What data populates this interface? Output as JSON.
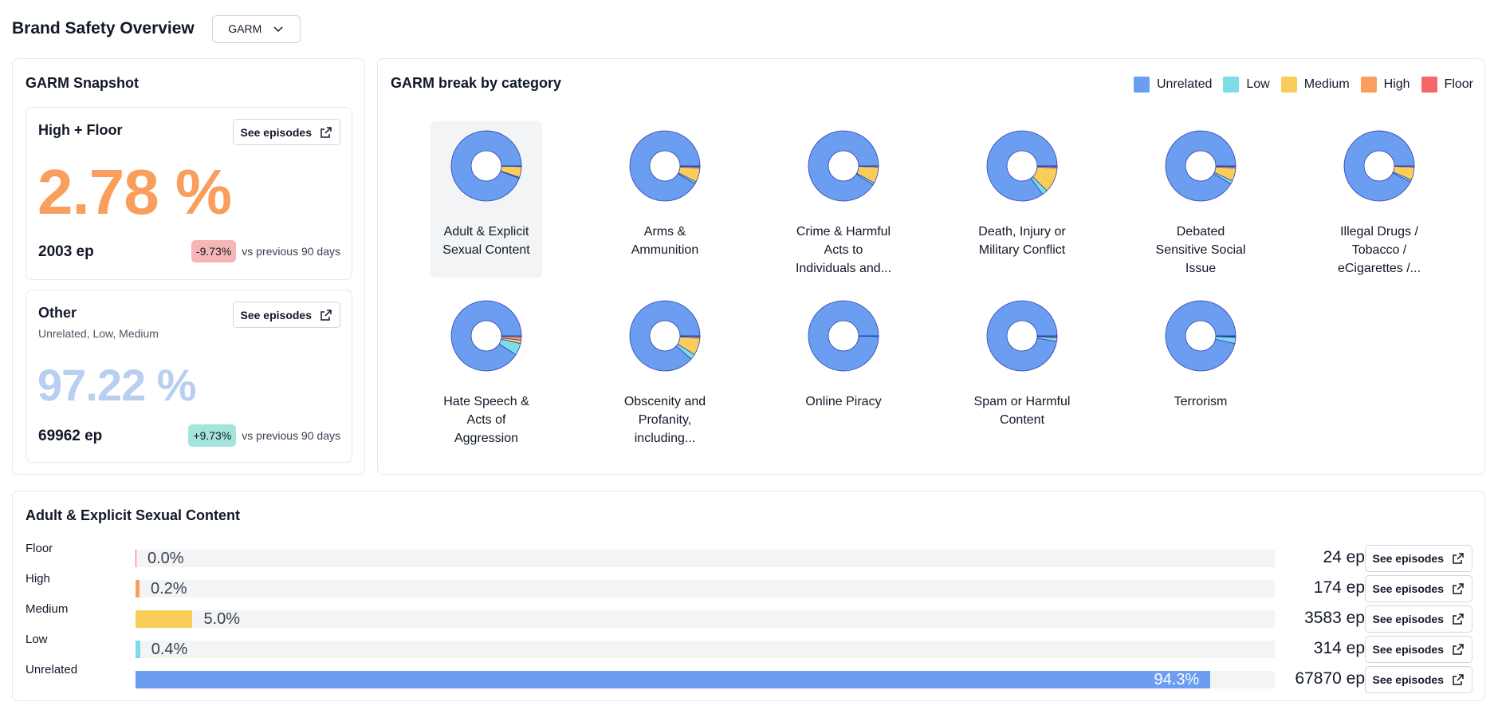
{
  "header": {
    "title": "Brand Safety Overview",
    "framework_select": "GARM"
  },
  "colors": {
    "unrelated": "#6b9ef0",
    "low": "#7ddde6",
    "medium": "#f9cd57",
    "high": "#f99e5c",
    "floor": "#f76666",
    "accent_orange": "#f99e5c",
    "accent_blue_light": "#b8cff2"
  },
  "snapshot": {
    "title": "GARM Snapshot",
    "high_floor": {
      "label": "High + Floor",
      "button": "See episodes",
      "percent": "2.78 %",
      "episodes": "2003 ep",
      "delta": "-9.73%",
      "delta_suffix": "vs previous 90 days"
    },
    "other": {
      "label": "Other",
      "sublabel": "Unrelated, Low, Medium",
      "button": "See episodes",
      "percent": "97.22 %",
      "episodes": "69962 ep",
      "delta": "+9.73%",
      "delta_suffix": "vs previous 90 days"
    }
  },
  "breakdown": {
    "title": "GARM break by category",
    "legend": [
      "Unrelated",
      "Low",
      "Medium",
      "High",
      "Floor"
    ],
    "categories": [
      {
        "name": "Adult & Explicit Sexual Content",
        "selected": true,
        "shares": [
          0.943,
          0.004,
          0.05,
          0.002,
          0.001
        ]
      },
      {
        "name": "Arms & Ammunition",
        "selected": false,
        "shares": [
          0.915,
          0.01,
          0.065,
          0.007,
          0.003
        ]
      },
      {
        "name": "Crime & Harmful Acts to Individuals and...",
        "selected": false,
        "shares": [
          0.91,
          0.01,
          0.075,
          0.004,
          0.001
        ]
      },
      {
        "name": "Death, Injury or Military Conflict",
        "selected": false,
        "shares": [
          0.85,
          0.025,
          0.115,
          0.007,
          0.003
        ]
      },
      {
        "name": "Debated Sensitive Social Issue",
        "selected": false,
        "shares": [
          0.915,
          0.015,
          0.06,
          0.007,
          0.003
        ]
      },
      {
        "name": "Illegal Drugs / Tobacco / eCigarettes /...",
        "selected": false,
        "shares": [
          0.925,
          0.01,
          0.06,
          0.004,
          0.001
        ]
      },
      {
        "name": "Hate Speech & Acts of Aggression",
        "selected": false,
        "shares": [
          0.91,
          0.055,
          0.015,
          0.015,
          0.005
        ]
      },
      {
        "name": "Obscenity and Profanity, including...",
        "selected": false,
        "shares": [
          0.885,
          0.025,
          0.08,
          0.007,
          0.003
        ]
      },
      {
        "name": "Online Piracy",
        "selected": false,
        "shares": [
          0.997,
          0.001,
          0.001,
          0.0005,
          0.0005
        ]
      },
      {
        "name": "Spam or Harmful Content",
        "selected": false,
        "shares": [
          0.975,
          0.015,
          0.006,
          0.003,
          0.001
        ]
      },
      {
        "name": "Terrorism",
        "selected": false,
        "shares": [
          0.965,
          0.028,
          0.004,
          0.002,
          0.001
        ]
      }
    ]
  },
  "detail": {
    "title": "Adult & Explicit Sexual Content",
    "rows": [
      {
        "label": "Floor",
        "percent": "0.0%",
        "value": 0.0,
        "episodes": "24 ep",
        "button": "See episodes",
        "color": "#f76666"
      },
      {
        "label": "High",
        "percent": "0.2%",
        "value": 0.2,
        "episodes": "174 ep",
        "button": "See episodes",
        "color": "#f99e5c"
      },
      {
        "label": "Medium",
        "percent": "5.0%",
        "value": 5.0,
        "episodes": "3583 ep",
        "button": "See episodes",
        "color": "#f9cd57"
      },
      {
        "label": "Low",
        "percent": "0.4%",
        "value": 0.4,
        "episodes": "314 ep",
        "button": "See episodes",
        "color": "#7ddde6"
      },
      {
        "label": "Unrelated",
        "percent": "94.3%",
        "value": 94.3,
        "episodes": "67870 ep",
        "button": "See episodes",
        "color": "#6b9ef0"
      }
    ]
  }
}
